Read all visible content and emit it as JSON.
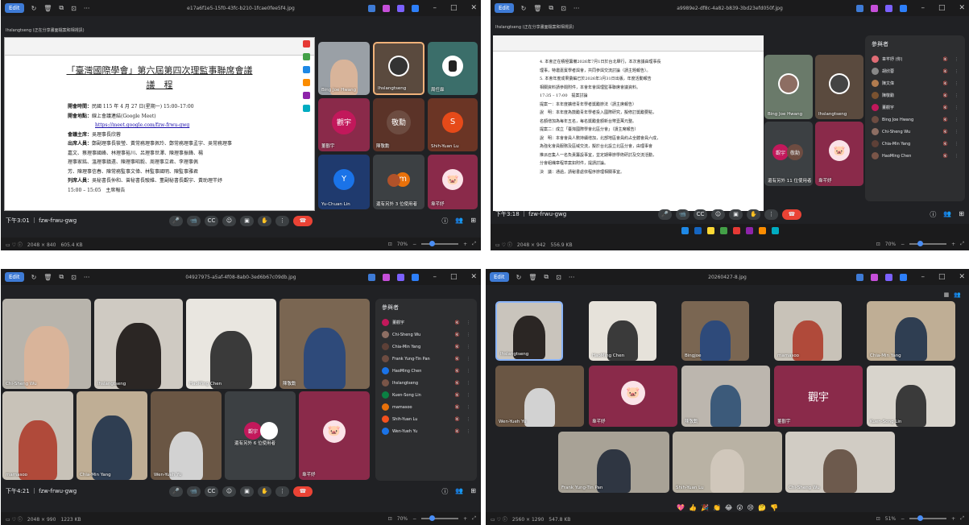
{
  "common": {
    "edit_label": "Edit",
    "caption_icon": "ⓘ",
    "call_code": "fzw-frwu-gwg"
  },
  "p1": {
    "filename": "e17a6f1e5-15f0-43fc-b210-1fcae0fee5f4.jpg",
    "presenter_banner": "Ihslangtseng (正在分享畫面檔案和相視訊)",
    "doc": {
      "title_line1": "「臺灣國際學會」第六屆第四次理監事聯席會議",
      "title_line2": "議　程",
      "rows": [
        {
          "k": "開會時間：",
          "v": "民國 115 年 4 月 27 日(星期一) 15:00–17:00"
        },
        {
          "k": "開會地點：",
          "v": "線上會議連結(Google Meet)"
        },
        {
          "k": "",
          "v": "https://meet.google.com/fzw-frwu-gwg",
          "link": true
        },
        {
          "k": "會議主席：",
          "v": "吳理事長欣蓉"
        },
        {
          "k": "出席人員：",
          "v": "鄭副理事長筱瑩、黃常務理事佩玲、鄭常務理事孟宇、吳常務理事"
        },
        {
          "k": "",
          "v": "嘉文、蔡理事國峰、林理事裕川、呂理事世澤、陳理事振鋒、楊"
        },
        {
          "k": "",
          "v": "理事家銘、溫理事鎮遠、陳理事昭毅、周理事立君、李理事佩"
        },
        {
          "k": "",
          "v": "芳、陳理事信春、陳常務監事文偉、林監事國明、陳監事雅君"
        },
        {
          "k": "列席人員：",
          "v": "吳秘書長仲和、曾秘書長駿維、董副秘書長觀宇、黃助理芊妤"
        },
        {
          "k": "",
          "v": "15:00 – 15:05　主席報告"
        }
      ]
    },
    "tiles": {
      "t1": "Bing Joe Hwang",
      "t2": "Ihslangtseng",
      "t3": "周任霖",
      "t4": "觀宇",
      "t4n": "董觀宇",
      "t5": "敬勳",
      "t5n": "陳敬勳",
      "t6": "S",
      "t6n": "Shih-Yuan Lu",
      "t7": "Y",
      "t7n": "Yu-Chuan Lin",
      "t8": "m",
      "t8n": "還有另外 3 位使用者",
      "t9n": "韋芊妤"
    },
    "time": "下午3:01 ｜ fzw-frwu-gwg",
    "status": "2048 × 840　605.4 KB",
    "zoom": "70%"
  },
  "p2": {
    "filename": "a9989e2-df8c-4a82-b839-3bd23efd050f.jpg",
    "presenter_banner": "Ihslangtseng (正在分享畫面檔案和相視訊)",
    "doc": {
      "lines": [
        "4. 本會正在積極籌備2026年7月1日於台北舉行，本次會議由理事長",
        "理事，特邀嘉賓學者與會，共同參與交流討論（請主題報告）。",
        "5. 本會年度成果彙編已於2026年3月31日出版，年度活動報告",
        "相關資料請參閱附件，本會年會與理監事聯席會議資料。",
        "17:35 – 17:00　提案討論",
        "提案一：本年度擴增青年學者獎勵辦法（請主席報告）",
        "說　明：本年度為鼓勵青年學者投入國際研究，擬修訂獎勵要點，",
        "名額增加為每年五名，每名獎勵金額新台幣壹萬元整。",
        "提案二：成立「臺灣國際學會北區分會」（請主席報告）",
        "說　明：本會會員人數持續增加，北部地區會員約占全體會員六成，",
        "為強化會員服務及區域交流，擬於台北設立北區分會，由理事會",
        "推派召集人一名負責籌設事宜，並定期舉辦學術研討及交流活動，",
        "分會組織章程草案如附件，提請討論。",
        "決　議：通過，請秘書處依程序辦理相關事宜。"
      ]
    },
    "tiles": {
      "t1": "Bing Joe Hwang",
      "t2": "Ihslangtseng",
      "t3a": "觀宇",
      "t3b": "敬勳",
      "t3n": "還有另外 11 位使用者",
      "t4n": "韋芊妤"
    },
    "participants_title": "參與者",
    "participants": [
      {
        "n": "韋芊妤 (你)",
        "c": "#e06c75"
      },
      {
        "n": "胡欣蓉",
        "c": "#888"
      },
      {
        "n": "陳文偉",
        "c": "#b07b4f"
      },
      {
        "n": "陳敬勳",
        "c": "#7a5230"
      },
      {
        "n": "董觀宇",
        "c": "#c2185b"
      },
      {
        "n": "Bing Joe Hwang",
        "c": "#6d4c41"
      },
      {
        "n": "Chi-Sheng Wu",
        "c": "#8d6e63"
      },
      {
        "n": "Chia-Min Yang",
        "c": "#5d4037"
      },
      {
        "n": "HaoMing Chen",
        "c": "#795548"
      }
    ],
    "time": "下午3:18 ｜ fzw-frwu-gwg",
    "status": "2048 × 942　556.9 KB",
    "zoom": "70%"
  },
  "p3": {
    "filename": "04927975-a5af-4f08-8ab0-3ed6b67c09db.jpg",
    "tiles": {
      "t1": "Chi-Sheng Wu",
      "t2": "Ihslangtseng",
      "t3": "HaoMing Chen",
      "t4": "陳敬勳",
      "t5": "mamasoo",
      "t6": "Chia-Min Yang",
      "t7": "Wen-Yueh Yu",
      "t8a": "觀宇",
      "t8n": "還有另外 6 位使用者",
      "t9n": "韋芊妤"
    },
    "participants_title": "參與者",
    "participants": [
      {
        "n": "董觀宇",
        "c": "#c2185b"
      },
      {
        "n": "Chi-Sheng Wu",
        "c": "#8d6e63"
      },
      {
        "n": "Chia-Min Yang",
        "c": "#5d4037"
      },
      {
        "n": "Frank Yung-Tin Pan",
        "c": "#6d4c41"
      },
      {
        "n": "HaoMing Chen",
        "c": "#1a73e8"
      },
      {
        "n": "Ihslangtseng",
        "c": "#795548"
      },
      {
        "n": "Kuen-Song Lin",
        "c": "#0b8043"
      },
      {
        "n": "mamasoo",
        "c": "#e8710a"
      },
      {
        "n": "Shih-Yuan Lu",
        "c": "#f4511e"
      },
      {
        "n": "Wen-Yueh Yu",
        "c": "#1a73e8"
      }
    ],
    "time": "下午4:21 ｜ fzw-frwu-gwg",
    "status": "2048 × 990　1223 KB",
    "zoom": "70%"
  },
  "p4": {
    "filename": "20260427-8.jpg",
    "tiles": {
      "t1": "Ihslangtseng",
      "t2": "HaoMing Chen",
      "t3": "Bingjoe",
      "t4": "mamasoo",
      "t5": "Chia-Min Yang",
      "t6": "Wen-Yueh Yu",
      "t7": "韋芊妤",
      "t8": "陳敬勳",
      "t9": "觀宇",
      "t9n": "董觀宇",
      "t10": "Kuen-Song Lin",
      "t11": "Frank Yung-Tin Pan",
      "t12": "Shih-Yuan Lu",
      "t13": "Chi-Sheng Wu"
    },
    "reactions": [
      "💖",
      "👍",
      "🎉",
      "👏",
      "😂",
      "😮",
      "😢",
      "🤔",
      "👎"
    ],
    "status": "2560 × 1290　547.8 KB",
    "zoom": "51%"
  },
  "colors": {
    "accent": "#3e7bd6",
    "end_call": "#ea4335",
    "pink_tile": "#8a2a4a"
  }
}
